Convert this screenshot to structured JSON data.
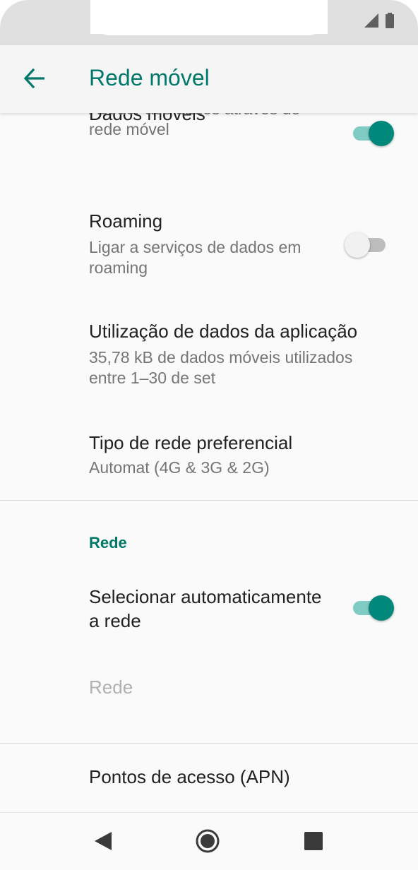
{
  "app_bar": {
    "title": "Rede móvel"
  },
  "icons": {
    "back": "arrow-left-icon",
    "signal": "signal-icon",
    "battery": "battery-icon"
  },
  "colors": {
    "accent": "#00796b",
    "switch_on_thumb": "#00897b",
    "switch_on_track": "#80cbc4"
  },
  "settings": {
    "mobile_data": {
      "title": "Dados móveis",
      "summary": "Aceder aos dados através de rede móvel",
      "enabled": true
    },
    "roaming": {
      "title": "Roaming",
      "summary": "Ligar a serviços de dados em roaming",
      "enabled": false
    },
    "app_data_usage": {
      "title": "Utilização de dados da aplicação",
      "summary": "35,78 kB de dados móveis utilizados entre 1–30 de set"
    },
    "preferred_network": {
      "title": "Tipo de rede preferencial",
      "summary": "Automat (4G & 3G & 2G)"
    }
  },
  "network_section": {
    "header": "Rede",
    "auto_select": {
      "title": "Selecionar automaticamente a rede",
      "enabled": true
    },
    "network": {
      "title": "Rede"
    }
  },
  "apn": {
    "title": "Pontos de acesso (APN)"
  },
  "nav": {
    "back": "nav-back-icon",
    "home": "nav-home-icon",
    "recents": "nav-recents-icon"
  }
}
